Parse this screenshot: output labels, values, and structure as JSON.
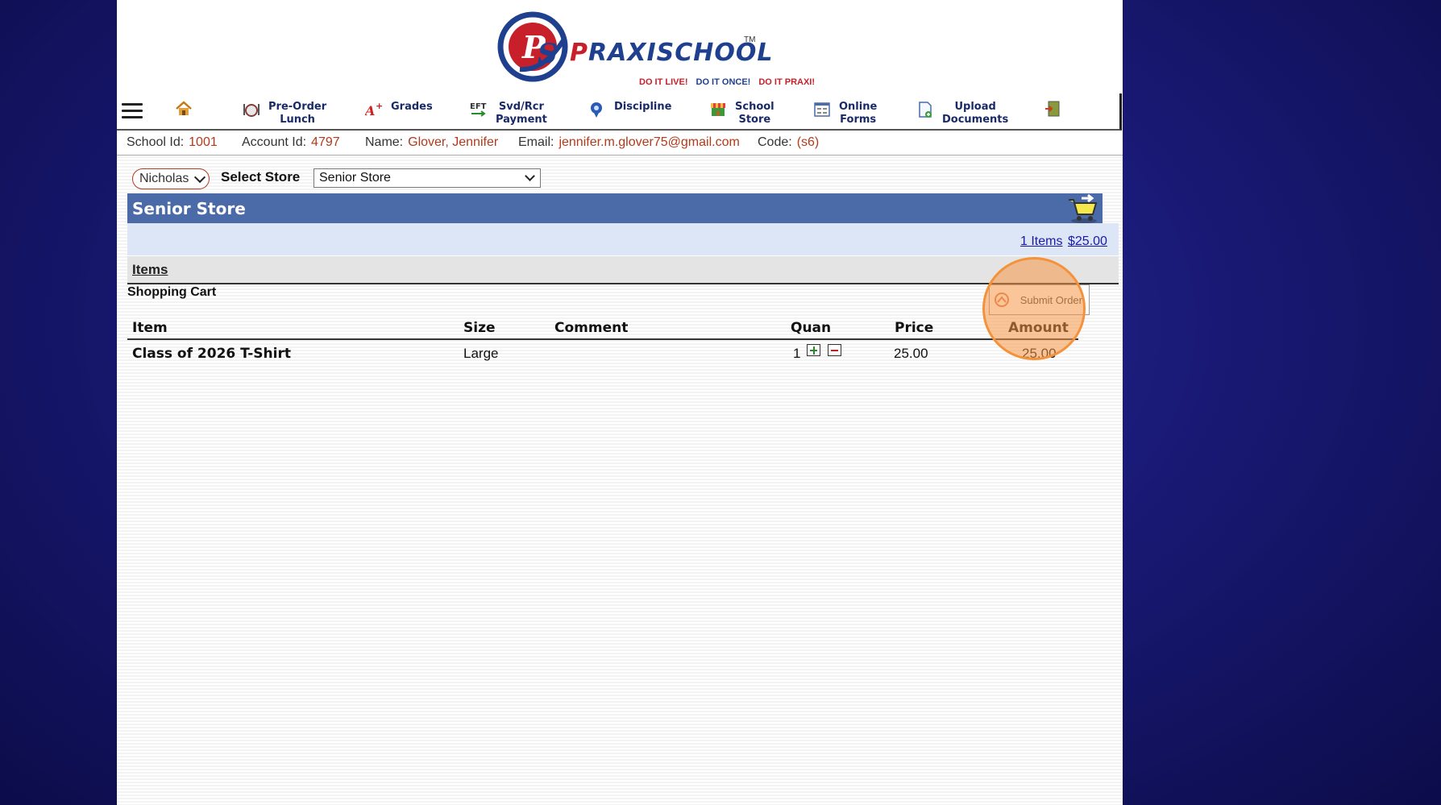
{
  "brand": {
    "name_prefix": "P",
    "name_rest": "RAXI",
    "name_school": "SCHOOL",
    "tm": "TM",
    "tagline": [
      "DO IT LIVE!",
      "DO IT ONCE!",
      "DO IT PRAXI!"
    ]
  },
  "nav": {
    "items": [
      {
        "label": "Pre-Order Lunch",
        "line1": "Pre-Order",
        "line2": "Lunch",
        "icon": "lunch-icon"
      },
      {
        "label": "Grades",
        "line1": "Grades",
        "line2": "",
        "icon": "grades-icon"
      },
      {
        "label": "Svd/Rcr Payment",
        "line1": "Svd/Rcr",
        "line2": "Payment",
        "icon": "eft-icon"
      },
      {
        "label": "Discipline",
        "line1": "Discipline",
        "line2": "",
        "icon": "discipline-icon"
      },
      {
        "label": "School Store",
        "line1": "School",
        "line2": "Store",
        "icon": "store-icon"
      },
      {
        "label": "Online Forms",
        "line1": "Online",
        "line2": "Forms",
        "icon": "forms-icon"
      },
      {
        "label": "Upload Documents",
        "line1": "Upload",
        "line2": "Documents",
        "icon": "upload-icon"
      }
    ],
    "eft_text": "EFT"
  },
  "account": {
    "school_id_label": "School Id:",
    "school_id": "1001",
    "account_id_label": "Account Id:",
    "account_id": "4797",
    "name_label": "Name:",
    "name": "Glover, Jennifer",
    "email_label": "Email:",
    "email": "jennifer.m.glover75@gmail.com",
    "code_label": "Code:",
    "code": "(s6)"
  },
  "selectors": {
    "student": "Nicholas",
    "store_label": "Select Store",
    "store": "Senior Store"
  },
  "store": {
    "title": "Senior Store",
    "items_count_link": "1 Items",
    "total_link": "$25.00",
    "items_tab": "Items"
  },
  "cart": {
    "title": "Shopping Cart",
    "submit_label": "Submit Order",
    "columns": [
      "Item",
      "Size",
      "Comment",
      "Quan",
      "Price",
      "Amount"
    ],
    "rows": [
      {
        "item": "Class of 2026 T-Shirt",
        "size": "Large",
        "comment": "",
        "quantity": "1",
        "price": "25.00",
        "amount": "25.00"
      }
    ]
  },
  "colors": {
    "accent_blue": "#4a6aa8",
    "value_red": "#b33a1a",
    "highlight_orange": "#f4923c"
  }
}
